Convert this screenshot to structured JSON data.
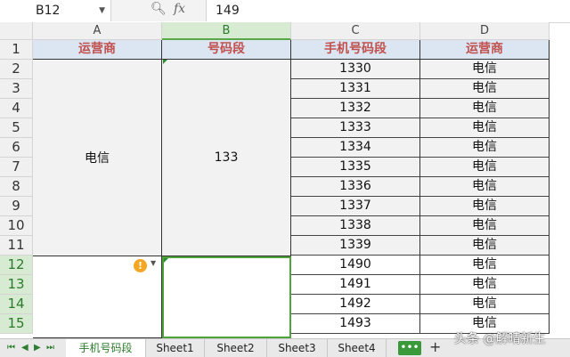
{
  "formula_bar": {
    "name_box": "B12",
    "fx": "fx",
    "value": "149"
  },
  "columns": [
    "A",
    "B",
    "C",
    "D"
  ],
  "rows": [
    "1",
    "2",
    "3",
    "4",
    "5",
    "6",
    "7",
    "8",
    "9",
    "10",
    "11",
    "12",
    "13",
    "14",
    "15"
  ],
  "headers": {
    "a": "运营商",
    "b": "号码段",
    "c": "手机号码段",
    "d": "运营商"
  },
  "merged": {
    "a": "电信",
    "b": "133"
  },
  "c_values": [
    "1330",
    "1331",
    "1332",
    "1333",
    "1334",
    "1335",
    "1336",
    "1337",
    "1338",
    "1339",
    "1490",
    "1491",
    "1492",
    "1493"
  ],
  "d_values": [
    "电信",
    "电信",
    "电信",
    "电信",
    "电信",
    "电信",
    "电信",
    "电信",
    "电信",
    "电信",
    "电信",
    "电信",
    "电信",
    "电信"
  ],
  "tabs": [
    "手机号码段",
    "Sheet1",
    "Sheet2",
    "Sheet3",
    "Sheet4"
  ],
  "more_label": "•••",
  "add_label": "+",
  "watermark": "头条 @解晴新生"
}
